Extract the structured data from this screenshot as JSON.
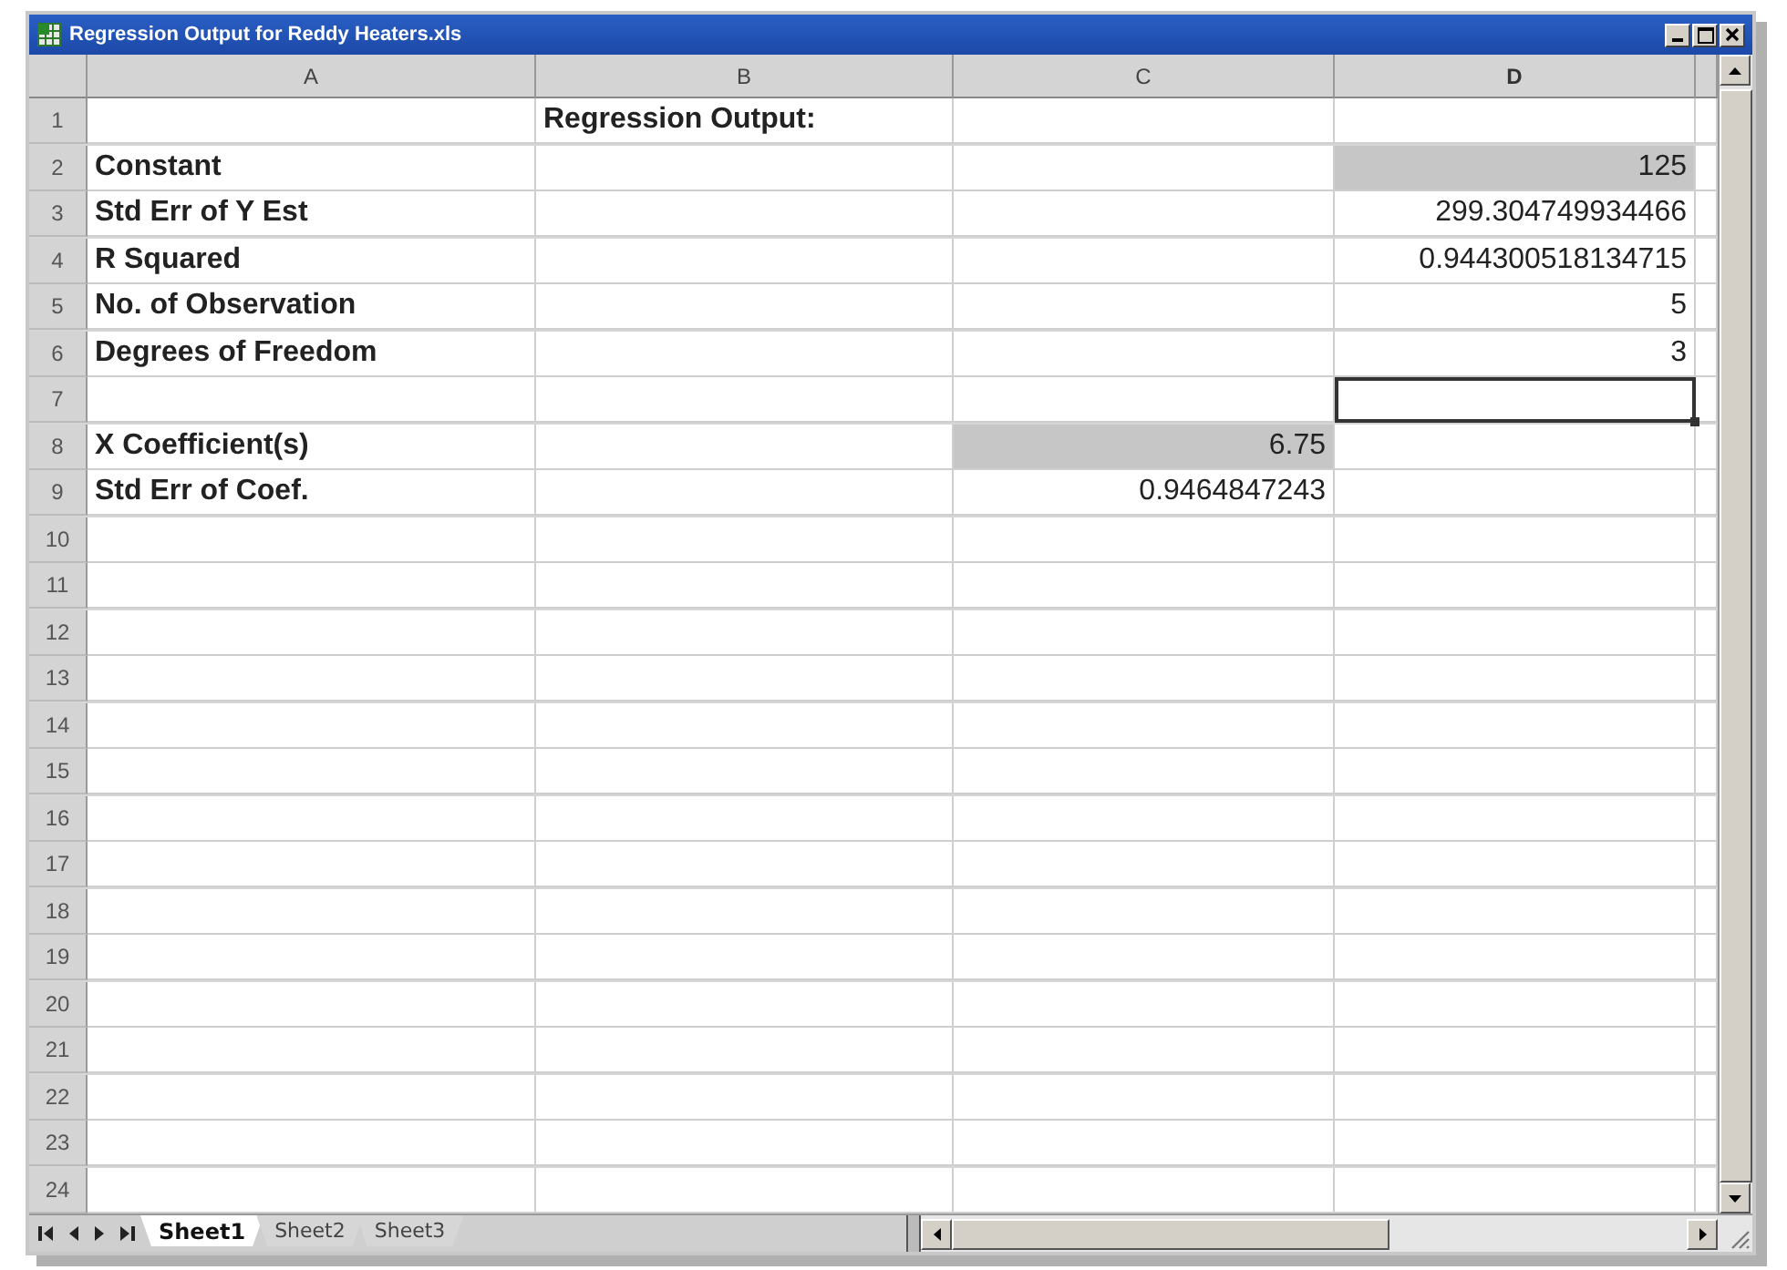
{
  "window": {
    "title": "Regression Output for Reddy Heaters.xls"
  },
  "columns": [
    "A",
    "B",
    "C",
    "D"
  ],
  "rows": [
    {
      "number": "1",
      "b": {
        "text": "Regression Output:",
        "kind": "label"
      }
    },
    {
      "number": "2",
      "a": {
        "text": "Constant",
        "kind": "label"
      },
      "d": {
        "text": "125",
        "kind": "number",
        "shaded": true
      }
    },
    {
      "number": "3",
      "a": {
        "text": "Std Err of Y Est",
        "kind": "label"
      },
      "d": {
        "text": "299.304749934466",
        "kind": "number"
      }
    },
    {
      "number": "4",
      "a": {
        "text": "R Squared",
        "kind": "label"
      },
      "d": {
        "text": "0.944300518134715",
        "kind": "number"
      }
    },
    {
      "number": "5",
      "a": {
        "text": "No. of Observation",
        "kind": "label"
      },
      "d": {
        "text": "5",
        "kind": "number"
      }
    },
    {
      "number": "6",
      "a": {
        "text": "Degrees of Freedom",
        "kind": "label"
      },
      "d": {
        "text": "3",
        "kind": "number"
      }
    },
    {
      "number": "7",
      "d": {
        "selected": true
      }
    },
    {
      "number": "8",
      "a": {
        "text": "X Coefficient(s)",
        "kind": "label"
      },
      "c": {
        "text": "6.75",
        "kind": "number",
        "shaded": true
      }
    },
    {
      "number": "9",
      "a": {
        "text": "Std Err of Coef.",
        "kind": "label"
      },
      "c": {
        "text": "0.9464847243",
        "kind": "number"
      }
    },
    {
      "number": "10"
    },
    {
      "number": "11"
    },
    {
      "number": "12"
    },
    {
      "number": "13"
    },
    {
      "number": "14"
    },
    {
      "number": "15"
    },
    {
      "number": "16"
    },
    {
      "number": "17"
    },
    {
      "number": "18"
    },
    {
      "number": "19"
    },
    {
      "number": "20"
    },
    {
      "number": "21"
    },
    {
      "number": "22"
    },
    {
      "number": "23"
    },
    {
      "number": "24"
    }
  ],
  "sheet_tabs": [
    {
      "label": "Sheet1",
      "selected": true
    },
    {
      "label": "Sheet2",
      "selected": false
    },
    {
      "label": "Sheet3",
      "selected": false
    }
  ]
}
